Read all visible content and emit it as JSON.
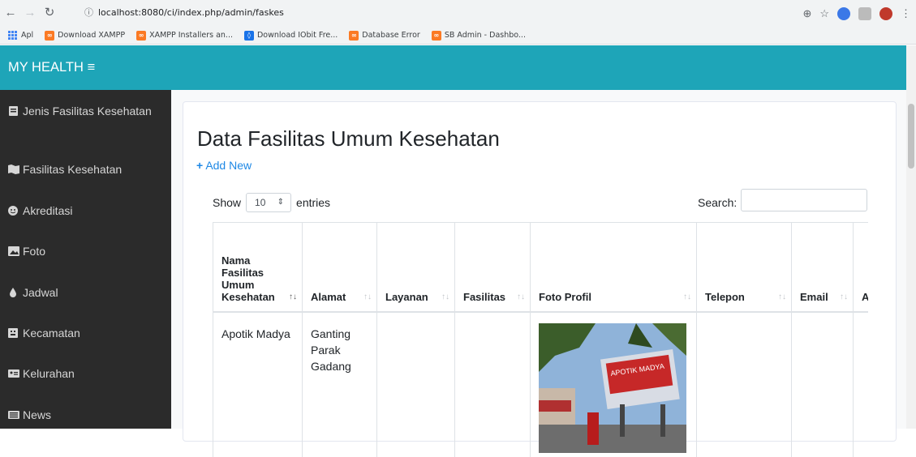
{
  "browser": {
    "url": "localhost:8080/ci/index.php/admin/faskes",
    "bookmarks": [
      "Apl",
      "Download XAMPP",
      "XAMPP Installers an...",
      "Download IObit Fre...",
      "Database Error",
      "SB Admin - Dashbo..."
    ]
  },
  "brand": "MY HEALTH ≡",
  "sidebar": {
    "items": [
      {
        "label": "Jenis Fasilitas Kesehatan",
        "icon": "book-icon"
      },
      {
        "label": "Fasilitas Kesehatan",
        "icon": "map-icon"
      },
      {
        "label": "Akreditasi",
        "icon": "smile-icon"
      },
      {
        "label": "Foto",
        "icon": "image-icon"
      },
      {
        "label": "Jadwal",
        "icon": "tint-icon"
      },
      {
        "label": "Kecamatan",
        "icon": "building-icon"
      },
      {
        "label": "Kelurahan",
        "icon": "id-card-icon"
      },
      {
        "label": "News",
        "icon": "newspaper-icon"
      }
    ]
  },
  "main": {
    "title": "Data Fasilitas Umum Kesehatan",
    "add_new": "Add New",
    "show_label": "Show",
    "entries_value": "10",
    "entries_label": "entries",
    "search_label": "Search:",
    "table": {
      "headers": [
        "Nama Fasilitas Umum Kesehatan",
        "Alamat",
        "Layanan",
        "Fasilitas",
        "Foto Profil",
        "Telepon",
        "Email",
        "A"
      ],
      "rows": [
        {
          "nama": "Apotik Madya",
          "alamat": "Ganting Parak Gadang",
          "layanan": "",
          "fasilitas": "",
          "foto_sign": "APOTIK MADYA",
          "telepon": "",
          "email": ""
        }
      ]
    }
  },
  "colors": {
    "topbar": "#1ea5b8",
    "sidebar": "#2b2b2b",
    "link": "#1e88e5"
  }
}
